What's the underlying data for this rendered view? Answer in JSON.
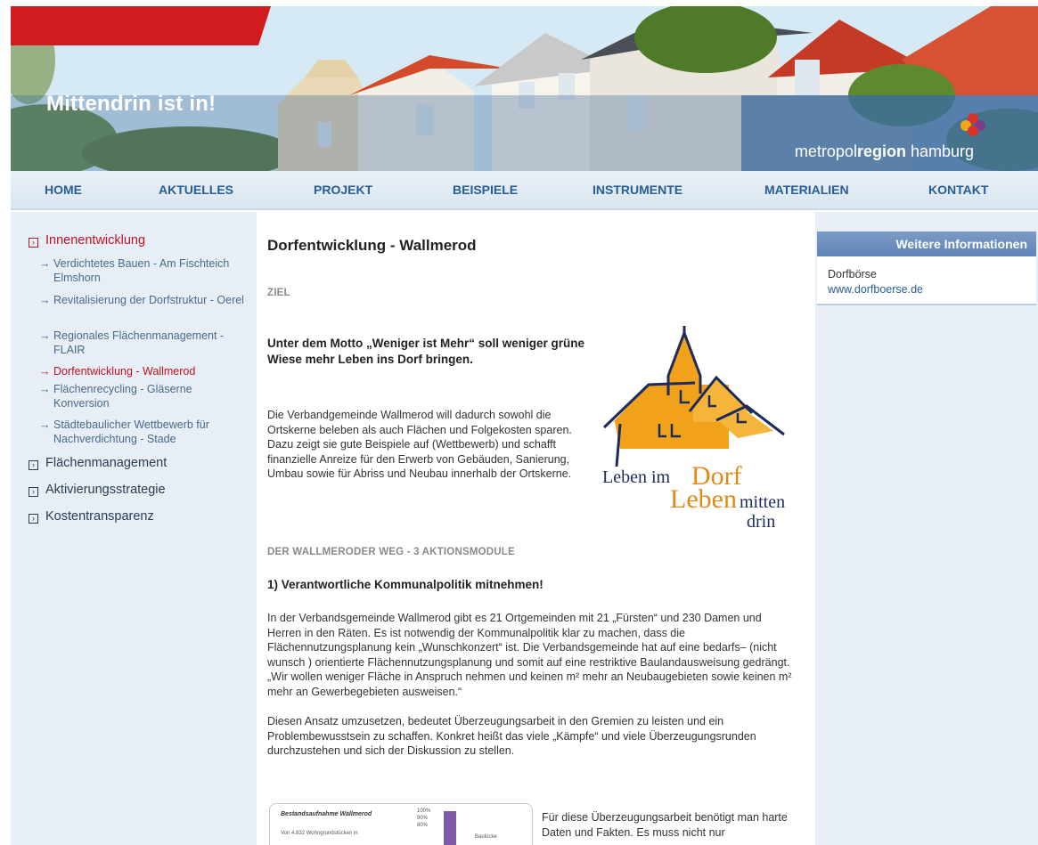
{
  "header": {
    "slogan": "Mittendrin ist in!",
    "brand_prefix": "metropol",
    "brand_bold": "region",
    "brand_suffix": " hamburg"
  },
  "nav": [
    {
      "label": "HOME"
    },
    {
      "label": "AKTUELLES"
    },
    {
      "label": "PROJEKT"
    },
    {
      "label": "BEISPIELE"
    },
    {
      "label": "INSTRUMENTE"
    },
    {
      "label": "MATERIALIEN"
    },
    {
      "label": "KONTAKT"
    }
  ],
  "sidebar": {
    "categories": [
      {
        "label": "Innenentwicklung"
      },
      {
        "label": "Flächenmanagement"
      },
      {
        "label": "Aktivierungsstrategie"
      },
      {
        "label": "Kostentransparenz"
      }
    ],
    "subitems": [
      {
        "label": "Verdichtetes Bauen - Am Fischteich Elmshorn"
      },
      {
        "label": "Revitalisierung der Dorfstruktur - Oerel"
      },
      {
        "label": "Regionales Flächenmanagement - FLAIR"
      },
      {
        "label": "Dorfentwicklung - Wallmerod"
      },
      {
        "label": "Flächenrecycling - Gläserne Konversion"
      },
      {
        "label": "Städtebaulicher Wettbewerb für Nachverdichtung - Stade"
      }
    ],
    "arrow": "→",
    "box": "›"
  },
  "main": {
    "title": "Dorfentwicklung - Wallmerod",
    "section_goal": "ZIEL",
    "lead": "Unter dem Motto „Weniger ist Mehr“ soll weniger grüne Wiese mehr Leben ins Dorf bringen.",
    "para1": "Die Verbandgemeinde Wallmerod will dadurch sowohl die Ortskerne beleben als auch Flächen und Folgekosten sparen. Dazu zeigt sie gute Beispiele auf (Wettbewerb) und schafft finanzielle Anreize für den Erwerb von Gebäuden, Sanierung, Umbau sowie für Abriss und Neubau innerhalb der Ortskerne.",
    "logo_line1a": "Leben im",
    "logo_line1b": "Dorf",
    "logo_line2a": "Leben",
    "logo_line2b": "mitten",
    "logo_line3": "drin",
    "section_weg": "DER WALLMERODER WEG - 3 AKTIONSMODULE",
    "h2": "1) Verantwortliche Kommunalpolitik mitnehmen!",
    "para2": "In der Verbandsgemeinde Wallmerod gibt es 21 Ortgemeinden mit 21 „Fürsten“ und 230 Damen und Herren in den Räten. Es ist notwendig der Kommunalpolitik klar zu machen, dass die Flächennutzungsplanung kein „Wunschkonzert“ ist. Die Verbandsgemeinde hat auf eine bedarfs– (nicht wunsch ) orientierte Flächennutzungsplanung und somit auf eine restriktive Baulandausweisung gedrängt. „Wir wollen weniger Fläche in Anspruch nehmen und keinen m² mehr an Neubaugebieten sowie keinen m² mehr an Gewerbegebieten ausweisen.“",
    "para3": "Diesen Ansatz umzusetzen, bedeutet Überzeugungsarbeit in den Gremien zu leisten und ein Problembewusstsein zu schaffen. Konkret heißt das viele „Kämpfe“ und viele Überzeugungsrunden durchzustehen und sich der Diskussion zu stellen.",
    "para4": "Für diese Überzeugungsarbeit benötigt man harte Daten und Fakten. Es muss nicht nur",
    "chart_title": "Bestandsaufnahme Wallmerod",
    "chart_note": "Von 4.832 Wohngrundstücken in",
    "chart_ticks": [
      "100%",
      "90%",
      "80%"
    ],
    "chart_legend": "Baulücke"
  },
  "right": {
    "heading": "Weitere Informationen",
    "item_label": "Dorfbörse",
    "item_link": "www.dorfboerse.de"
  },
  "colors": {
    "accent_red": "#c0121f",
    "nav_blue": "#2a5d95",
    "sidebar_bg": "#e7eef6",
    "logo_orange": "#f2a11a",
    "logo_navy": "#1d2a5c",
    "logo_text_orange": "#e08a17"
  }
}
